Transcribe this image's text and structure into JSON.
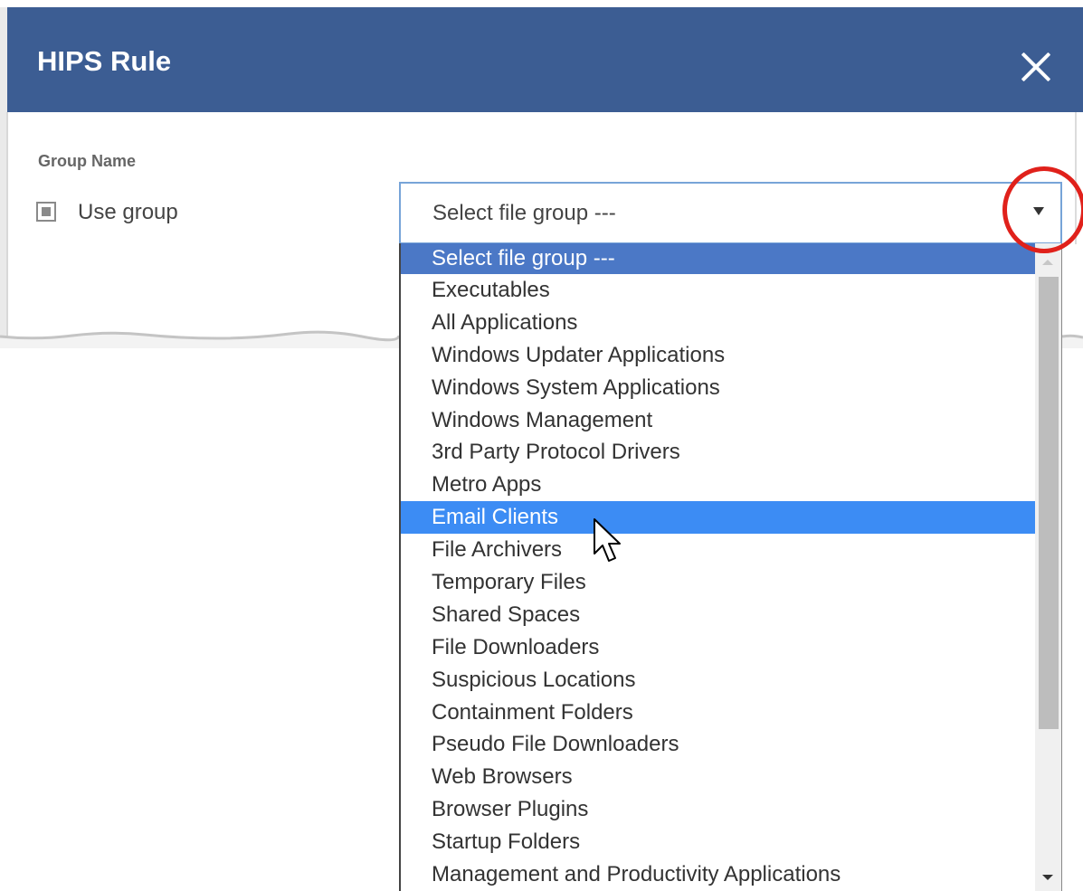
{
  "dialog": {
    "title": "HIPS Rule",
    "close_icon": "close-icon"
  },
  "form": {
    "group_label": "Group Name",
    "use_group_label": "Use group",
    "use_group_checked": "indeterminate"
  },
  "select": {
    "selected_value": "Select file group ---",
    "arrow_icon": "chevron-down-icon",
    "options": [
      "Select file group ---",
      "Executables",
      "All Applications",
      "Windows Updater Applications",
      "Windows System Applications",
      "Windows Management",
      "3rd Party Protocol Drivers",
      "Metro Apps",
      "Email Clients",
      "File Archivers",
      "Temporary Files",
      "Shared Spaces",
      "File Downloaders",
      "Suspicious Locations",
      "Containment Folders",
      "Pseudo File Downloaders",
      "Web Browsers",
      "Browser Plugins",
      "Startup Folders",
      "Management and Productivity Applications"
    ],
    "hovered_option": "Email Clients"
  },
  "colors": {
    "header": "#3c5d93",
    "selected": "#4b78c6",
    "hover": "#3c8cf4",
    "callout": "#e0211b"
  }
}
